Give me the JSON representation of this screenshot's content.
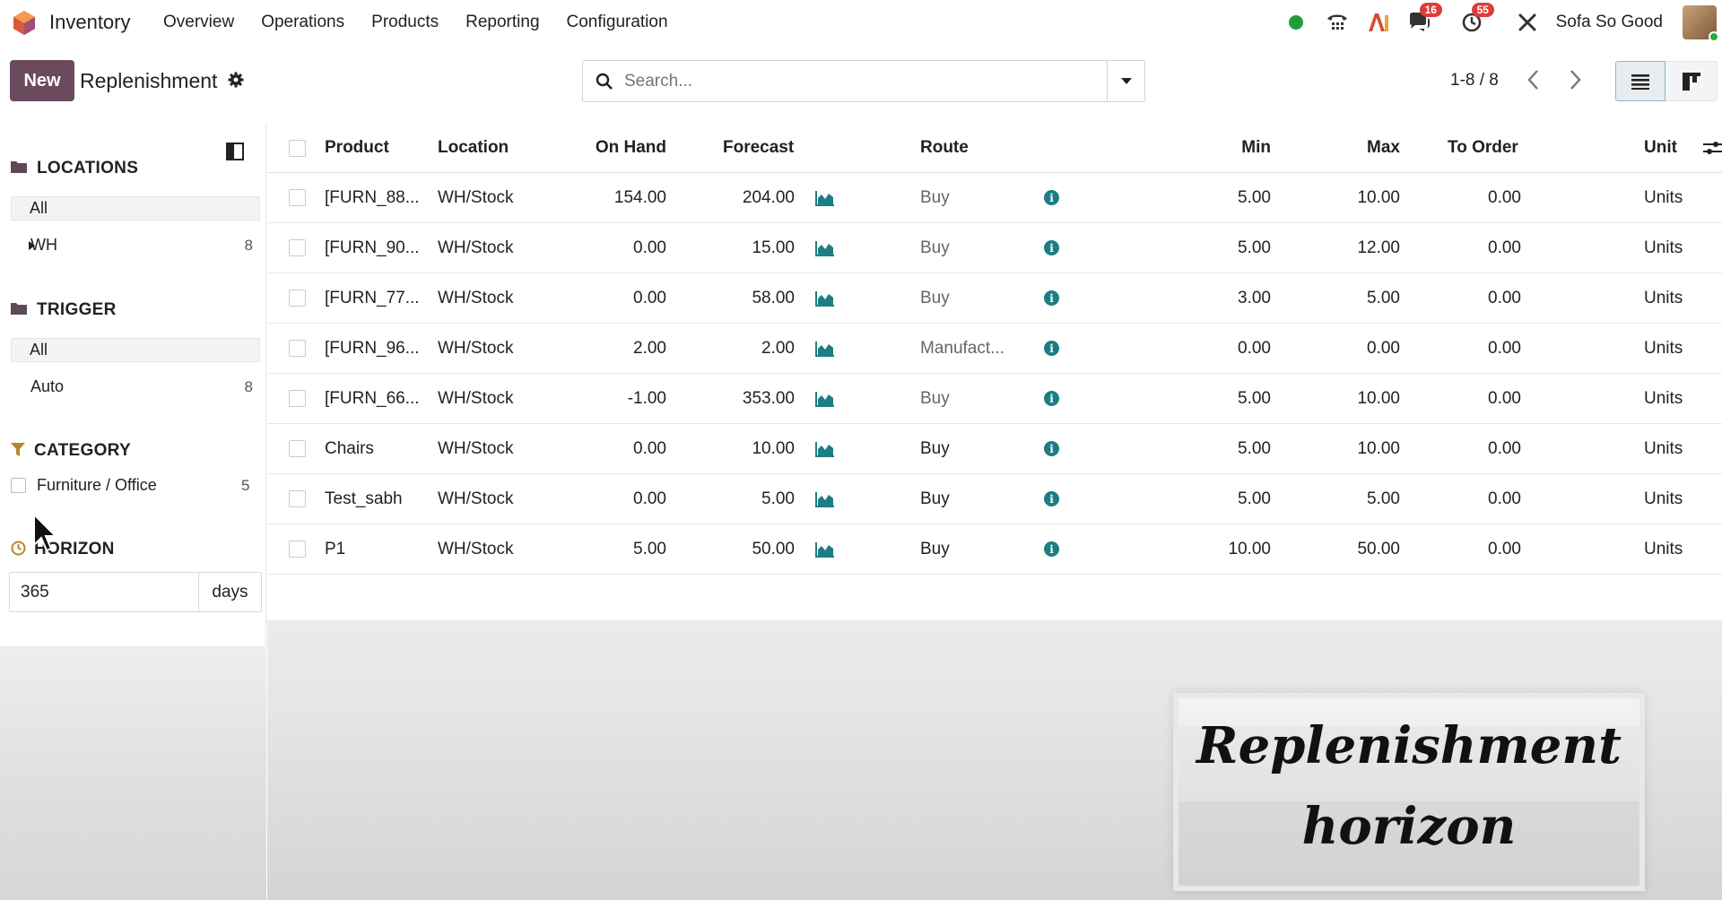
{
  "app": {
    "name": "Inventory"
  },
  "menu": [
    "Overview",
    "Operations",
    "Products",
    "Reporting",
    "Configuration"
  ],
  "systray": {
    "discuss_badge": "16",
    "activity_badge": "55",
    "user": "Sofa So Good"
  },
  "control": {
    "new_label": "New",
    "title": "Replenishment",
    "search_placeholder": "Search...",
    "pager": "1-8 / 8"
  },
  "sidebar": {
    "locations": {
      "title": "LOCATIONS",
      "all": "All",
      "items": [
        {
          "label": "WH",
          "count": "8"
        }
      ]
    },
    "trigger": {
      "title": "TRIGGER",
      "all": "All",
      "items": [
        {
          "label": "Auto",
          "count": "8"
        }
      ]
    },
    "category": {
      "title": "CATEGORY",
      "items": [
        {
          "label": "Furniture / Office",
          "count": "5"
        }
      ]
    },
    "horizon": {
      "title": "HORIZON",
      "value": "365",
      "unit": "days"
    }
  },
  "table": {
    "headers": {
      "product": "Product",
      "location": "Location",
      "on_hand": "On Hand",
      "forecast": "Forecast",
      "route": "Route",
      "min": "Min",
      "max": "Max",
      "to_order": "To Order",
      "unit": "Unit"
    },
    "rows": [
      {
        "product": "[FURN_88...",
        "location": "WH/Stock",
        "on_hand": "154.00",
        "forecast": "204.00",
        "route": "Buy",
        "min": "5.00",
        "max": "10.00",
        "to_order": "0.00",
        "unit": "Units"
      },
      {
        "product": "[FURN_90...",
        "location": "WH/Stock",
        "on_hand": "0.00",
        "forecast": "15.00",
        "route": "Buy",
        "min": "5.00",
        "max": "12.00",
        "to_order": "0.00",
        "unit": "Units"
      },
      {
        "product": "[FURN_77...",
        "location": "WH/Stock",
        "on_hand": "0.00",
        "forecast": "58.00",
        "route": "Buy",
        "min": "3.00",
        "max": "5.00",
        "to_order": "0.00",
        "unit": "Units"
      },
      {
        "product": "[FURN_96...",
        "location": "WH/Stock",
        "on_hand": "2.00",
        "forecast": "2.00",
        "route": "Manufact...",
        "min": "0.00",
        "max": "0.00",
        "to_order": "0.00",
        "unit": "Units"
      },
      {
        "product": "[FURN_66...",
        "location": "WH/Stock",
        "on_hand": "-1.00",
        "forecast": "353.00",
        "route": "Buy",
        "min": "5.00",
        "max": "10.00",
        "to_order": "0.00",
        "unit": "Units"
      },
      {
        "product": "Chairs",
        "location": "WH/Stock",
        "on_hand": "0.00",
        "forecast": "10.00",
        "route": "Buy",
        "min": "5.00",
        "max": "10.00",
        "to_order": "0.00",
        "unit": "Units"
      },
      {
        "product": "Test_sabh",
        "location": "WH/Stock",
        "on_hand": "0.00",
        "forecast": "5.00",
        "route": "Buy",
        "min": "5.00",
        "max": "5.00",
        "to_order": "0.00",
        "unit": "Units"
      },
      {
        "product": "P1",
        "location": "WH/Stock",
        "on_hand": "5.00",
        "forecast": "50.00",
        "route": "Buy",
        "min": "10.00",
        "max": "50.00",
        "to_order": "0.00",
        "unit": "Units"
      }
    ]
  },
  "annotation": {
    "line1": "Replenishment",
    "line2": "horizon"
  },
  "colors": {
    "brand": "#6c4a5e",
    "info": "#1c7e82",
    "badge": "#e03b3b",
    "online": "#28a745"
  }
}
